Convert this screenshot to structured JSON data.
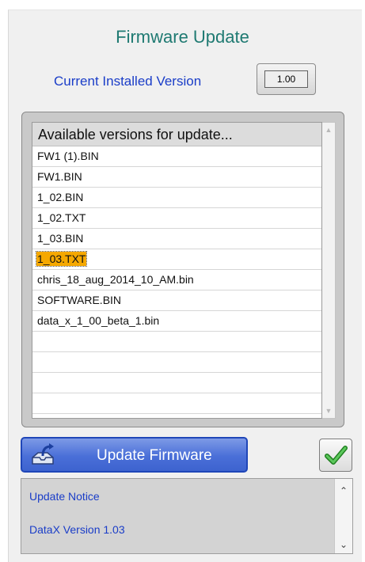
{
  "header": {
    "title": "Firmware Update",
    "version_label": "Current Installed Version",
    "version_value": "1.00"
  },
  "versions_list": {
    "header": "Available versions for update...",
    "items": [
      {
        "label": "FW1 (1).BIN",
        "selected": false
      },
      {
        "label": "FW1.BIN",
        "selected": false
      },
      {
        "label": "1_02.BIN",
        "selected": false
      },
      {
        "label": "1_02.TXT",
        "selected": false
      },
      {
        "label": "1_03.BIN",
        "selected": false
      },
      {
        "label": "1_03.TXT",
        "selected": true
      },
      {
        "label": "chris_18_aug_2014_10_AM.bin",
        "selected": false
      },
      {
        "label": "SOFTWARE.BIN",
        "selected": false
      },
      {
        "label": "data_x_1_00_beta_1.bin",
        "selected": false
      },
      {
        "label": "",
        "selected": false
      },
      {
        "label": "",
        "selected": false
      },
      {
        "label": "",
        "selected": false
      },
      {
        "label": "",
        "selected": false
      }
    ],
    "scroll_up_icon": "triangle-up",
    "scroll_down_icon": "triangle-down"
  },
  "actions": {
    "update_button_label": "Update Firmware",
    "update_button_icon": "upload-arrow-icon",
    "confirm_icon": "checkmark-icon"
  },
  "notice": {
    "title": "Update Notice",
    "body": "DataX Version 1.03"
  },
  "colors": {
    "title": "#1f7a72",
    "label_blue": "#1a3dc8",
    "selected_highlight": "#f5a800",
    "button_blue": "#4a6fd8",
    "check_green": "#2fa02f"
  }
}
